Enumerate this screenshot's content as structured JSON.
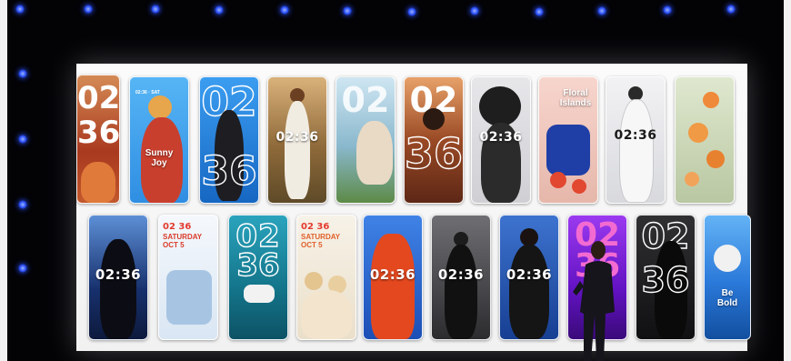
{
  "screen": {
    "lockscreen_time": "02:36",
    "top_row": [
      {
        "id": "c1",
        "big_top": "02",
        "big_bottom": "36",
        "label": "",
        "bg": "#b0472a"
      },
      {
        "id": "c2",
        "date": "02:36 · SAT",
        "label": "Sunny\nJoy",
        "bg": "#3aa2ee"
      },
      {
        "id": "c3",
        "big_top": "02",
        "big_bottom": "36",
        "label": "",
        "bg": "#1c79d3"
      },
      {
        "id": "c4",
        "time": "02:36",
        "label": "",
        "bg": "#8a5a2a"
      },
      {
        "id": "c5",
        "big_top": "02",
        "big_bottom": "36",
        "label": "",
        "bg": "#9bc6d9"
      },
      {
        "id": "c6",
        "big_top": "02",
        "big_bottom": "36",
        "label": "",
        "bg": "#7b3c22"
      },
      {
        "id": "c7",
        "time": "02:36",
        "label": "",
        "bg": "#d9d9dc"
      },
      {
        "id": "c8",
        "label": "Floral\nIslands",
        "bg": "#f3c7c0"
      },
      {
        "id": "c9",
        "time": "02:36",
        "label": "",
        "bg": "#e6e7ea"
      },
      {
        "id": "c10",
        "label": "",
        "bg": "#e7e9d9"
      }
    ],
    "bottom_row": [
      {
        "id": "d1",
        "time": "02:36",
        "label": "",
        "bg": "#1b3a7a"
      },
      {
        "id": "d2",
        "big_top": "02 36",
        "big_bottom": "SATURDAY\nOCT 5",
        "label": "",
        "bg": "#eef4fb"
      },
      {
        "id": "d3",
        "big_top": "02",
        "big_bottom": "36",
        "label": "",
        "bg": "#1e8fa3"
      },
      {
        "id": "d4",
        "big_top": "02 36",
        "big_bottom": "SATURDAY\nOCT 5",
        "label": "",
        "bg": "#f4efe6"
      },
      {
        "id": "d5",
        "time": "02:36",
        "label": "",
        "bg": "#1f57c9"
      },
      {
        "id": "d6",
        "time": "02:36",
        "label": "",
        "bg": "#3d3d40"
      },
      {
        "id": "d7",
        "time": "02:36",
        "label": "",
        "bg": "#1d4fae"
      },
      {
        "id": "d8",
        "big_top": "02",
        "big_bottom": "36",
        "label": "",
        "bg": "#7e1fd6"
      },
      {
        "id": "d9",
        "big_top": "02",
        "big_bottom": "36",
        "label": "",
        "bg": "#1b1b1b"
      },
      {
        "id": "d10",
        "label": "Be\nBold",
        "bg": "#2f7fe0"
      }
    ]
  },
  "colors": {
    "accent_light": "#2e55ff",
    "screen": "#f6f6f6",
    "stage": "#030306"
  }
}
